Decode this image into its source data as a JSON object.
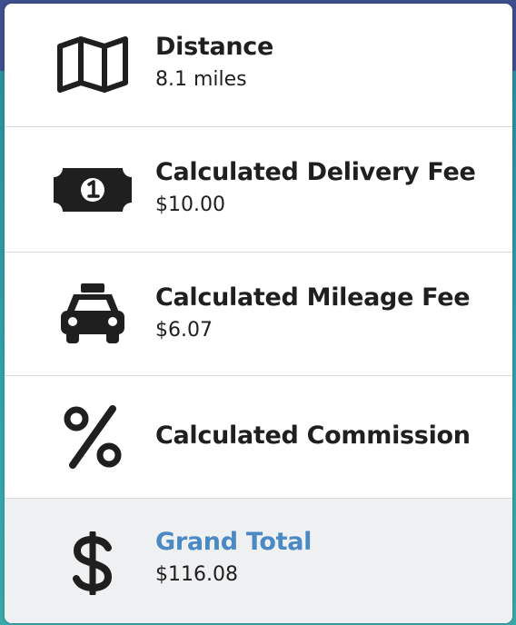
{
  "summary": {
    "rows": [
      {
        "label": "Distance",
        "value": "8.1 miles",
        "icon": "map-icon"
      },
      {
        "label": "Calculated Delivery Fee",
        "value": "$10.00",
        "icon": "money-bill-icon"
      },
      {
        "label": "Calculated Mileage Fee",
        "value": "$6.07",
        "icon": "taxi-icon"
      },
      {
        "label": "Calculated Commission",
        "value": "",
        "icon": "percent-icon"
      },
      {
        "label": "Grand Total",
        "value": "$116.08",
        "icon": "dollar-icon"
      }
    ]
  },
  "colors": {
    "accent": "#4a89c4",
    "text": "#1f1f1f",
    "highlight_row_bg": "#eff0f2",
    "divider": "#d8d8d8"
  }
}
